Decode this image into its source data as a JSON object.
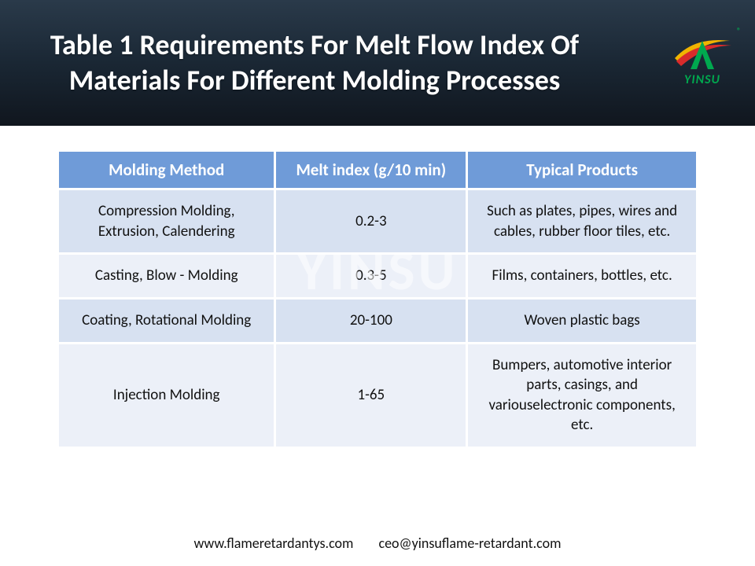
{
  "header": {
    "title": "Table 1 Requirements For Melt Flow Index Of Materials For Different Molding Processes",
    "logo_text": "YINSU",
    "reg": "®"
  },
  "watermark": "YINSU",
  "chart_data": {
    "type": "table",
    "title": "Table 1 Requirements For Melt Flow Index Of Materials For Different Molding Processes",
    "columns": [
      "Molding Method",
      "Melt index (g/10 min)",
      "Typical Products"
    ],
    "rows": [
      {
        "method": "Compression Molding, Extrusion, Calendering",
        "melt_index": "0.2-3",
        "products": "Such as plates, pipes, wires and cables, rubber floor tiles, etc."
      },
      {
        "method": "Casting, Blow - Molding",
        "melt_index": "0.3-5",
        "products": "Films, containers, bottles, etc."
      },
      {
        "method": "Coating, Rotational Molding",
        "melt_index": "20-100",
        "products": "Woven plastic bags"
      },
      {
        "method": "Injection Molding",
        "melt_index": "1-65",
        "products": "Bumpers, automotive interior parts, casings, and variouselectronic components, etc."
      }
    ]
  },
  "footer": {
    "url": "www.flameretardantys.com",
    "email": "ceo@yinsuflame-retardant.com"
  }
}
